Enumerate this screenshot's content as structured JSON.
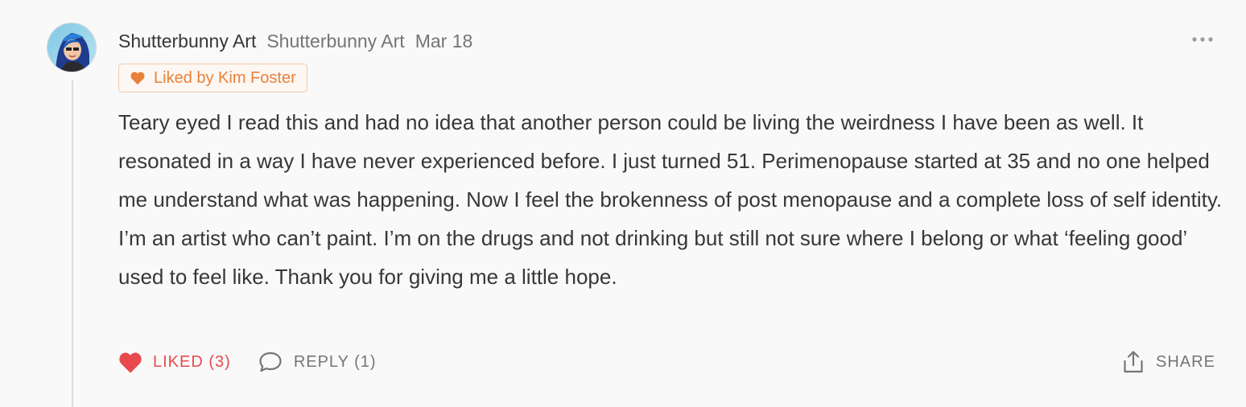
{
  "comment": {
    "author": "Shutterbunny Art",
    "publication": "Shutterbunny Art",
    "date": "Mar 18",
    "liked_by": "Liked by Kim Foster",
    "body": "Teary eyed I read this and had no idea that another person could be living the weirdness I have been as well. It resonated in a way I have never experienced before. I just turned 51. Perimenopause started at 35 and no one helped me understand what was happening. Now I feel the brokenness of post menopause and a complete loss of self identity. I’m an artist who can’t paint. I’m on the drugs and not drinking but still not sure where I belong or what ‘feeling good’ used to feel like. Thank you for giving me a little hope."
  },
  "actions": {
    "like_label": "LIKED (3)",
    "reply_label": "REPLY (1)",
    "share_label": "SHARE"
  },
  "icons": {
    "avatar": "avatar-photo",
    "more": "more-horizontal-icon",
    "liked_heart": "heart-icon",
    "like": "heart-filled-icon",
    "reply": "speech-bubble-icon",
    "share": "share-icon"
  },
  "colors": {
    "accent_orange": "#e8813a",
    "liked_red": "#e8494d",
    "text_primary": "#363737",
    "text_secondary": "#757575",
    "background": "#f9f9f9"
  }
}
